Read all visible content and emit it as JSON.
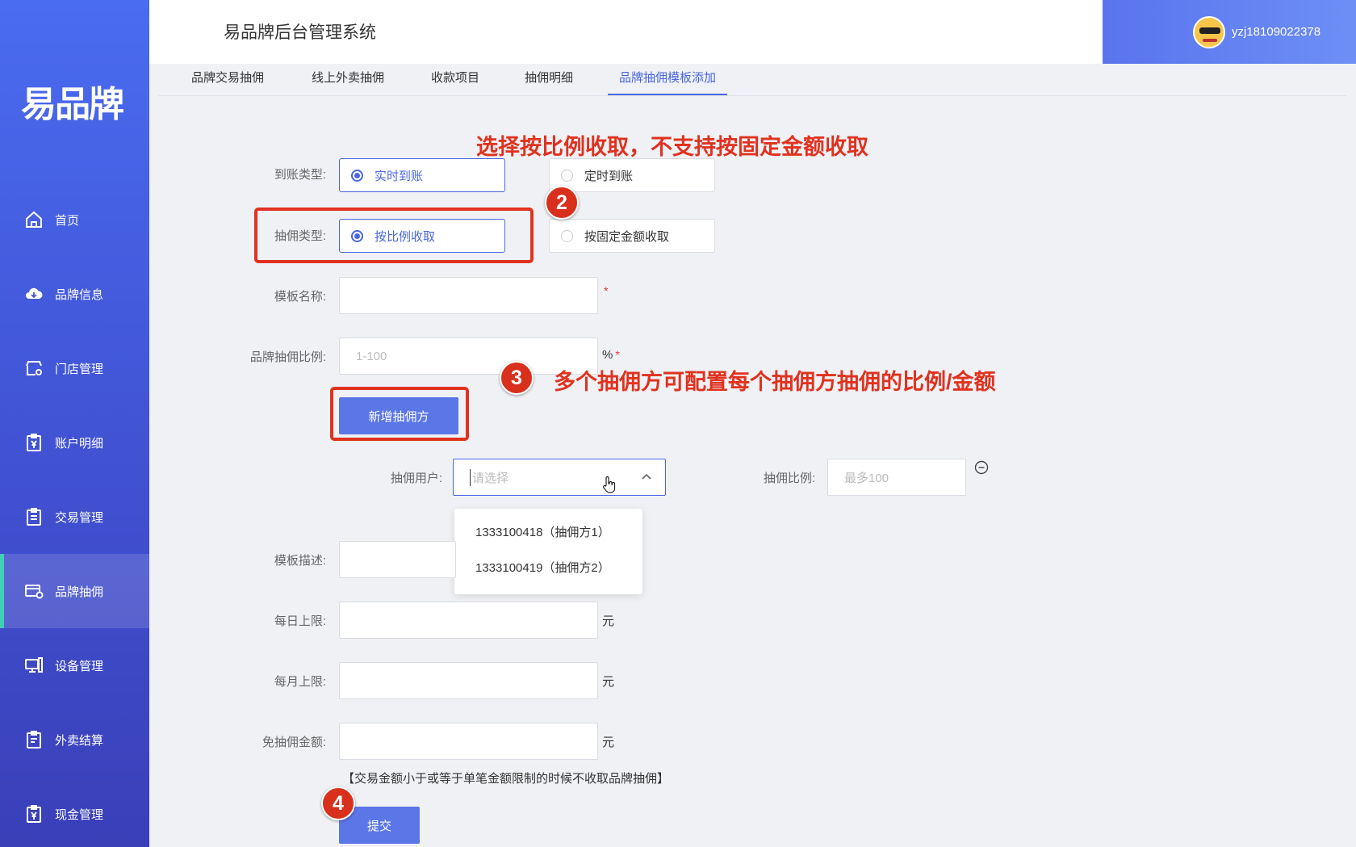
{
  "app": {
    "title": "易品牌后台管理系统",
    "logo_text": "易品牌",
    "username": "yzj18109022378"
  },
  "sidebar": {
    "items": [
      {
        "label": "首页",
        "icon": "home-icon"
      },
      {
        "label": "品牌信息",
        "icon": "cloud-icon"
      },
      {
        "label": "门店管理",
        "icon": "store-icon"
      },
      {
        "label": "账户明细",
        "icon": "clipboard-yen-icon"
      },
      {
        "label": "交易管理",
        "icon": "clipboard-icon"
      },
      {
        "label": "品牌抽佣",
        "icon": "card-icon",
        "active": true
      },
      {
        "label": "设备管理",
        "icon": "monitor-icon"
      },
      {
        "label": "外卖结算",
        "icon": "clipboard-list-icon"
      },
      {
        "label": "现金管理",
        "icon": "cash-yen-icon"
      }
    ]
  },
  "tabs": [
    "品牌交易抽佣",
    "线上外卖抽佣",
    "收款项目",
    "抽佣明细",
    "品牌抽佣模板添加"
  ],
  "active_tab": "品牌抽佣模板添加",
  "form": {
    "arrival_type": {
      "label": "到账类型:",
      "options": [
        "实时到账",
        "定时到账"
      ],
      "selected": "实时到账"
    },
    "commission_type": {
      "label": "抽佣类型:",
      "options": [
        "按比例收取",
        "按固定金额收取"
      ],
      "selected": "按比例收取"
    },
    "template_name": {
      "label": "模板名称:",
      "value": "",
      "required": "*"
    },
    "brand_ratio": {
      "label": "品牌抽佣比例:",
      "placeholder": "1-100",
      "unit": "%",
      "required": "*"
    },
    "add_party_button": "新增抽佣方",
    "commission_user": {
      "label": "抽佣用户:",
      "placeholder": "请选择",
      "dropdown_open": true,
      "options": [
        "1333100418（抽佣方1）",
        "1333100419（抽佣方2）"
      ]
    },
    "commission_ratio": {
      "label": "抽佣比例:",
      "placeholder": "最多100"
    },
    "template_desc": {
      "label": "模板描述:",
      "value": ""
    },
    "daily_limit": {
      "label": "每日上限:",
      "unit": "元"
    },
    "monthly_limit": {
      "label": "每月上限:",
      "unit": "元"
    },
    "exempt_amount": {
      "label": "免抽佣金额:",
      "unit": "元"
    },
    "note": "【交易金额小于或等于单笔金额限制的时候不收取品牌抽佣】",
    "submit_button": "提交"
  },
  "annotations": {
    "text_top": "选择按比例收取，不支持按固定金额收取",
    "text_mid": "多个抽佣方可配置每个抽佣方抽佣的比例/金额",
    "badge2": "2",
    "badge3": "3",
    "badge4": "4",
    "color": "#e0321f"
  }
}
